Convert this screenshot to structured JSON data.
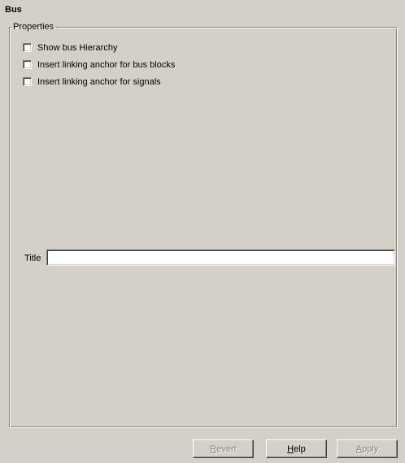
{
  "panel": {
    "title": "Bus"
  },
  "properties": {
    "legend": "Properties",
    "checkboxes": [
      {
        "label": "Show bus Hierarchy",
        "checked": false
      },
      {
        "label": "Insert linking anchor for bus blocks",
        "checked": false
      },
      {
        "label": "Insert linking anchor for signals",
        "checked": false
      }
    ],
    "title_label": "Title",
    "title_value": ""
  },
  "buttons": {
    "revert": {
      "mnemonic": "R",
      "rest": "evert",
      "enabled": false
    },
    "help": {
      "mnemonic": "H",
      "rest": "elp",
      "enabled": true
    },
    "apply": {
      "mnemonic": "A",
      "rest": "pply",
      "enabled": false
    }
  }
}
